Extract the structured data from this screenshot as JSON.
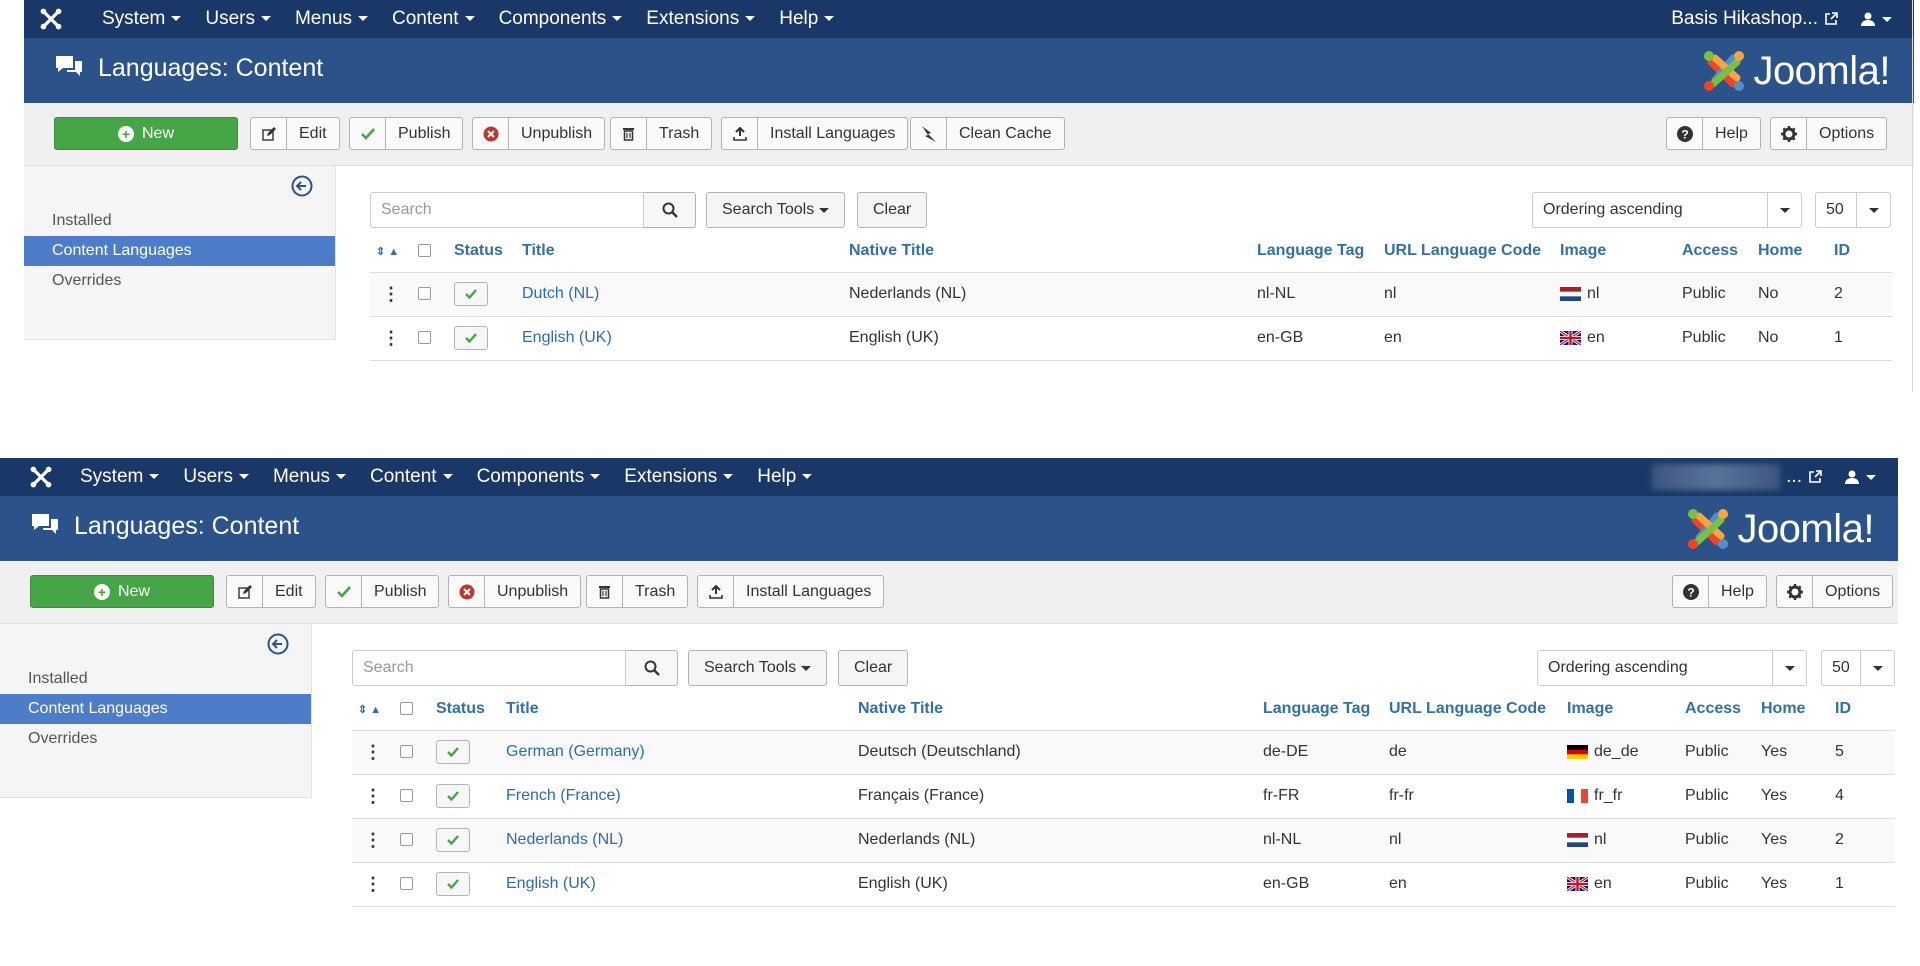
{
  "shots": [
    {
      "menu": [
        "System",
        "Users",
        "Menus",
        "Content",
        "Components",
        "Extensions",
        "Help"
      ],
      "site_link": "Basis Hikashop...",
      "title": "Languages: Content",
      "brand": "Joomla!",
      "toolbar": {
        "new": "New",
        "edit": "Edit",
        "publish": "Publish",
        "unpublish": "Unpublish",
        "trash": "Trash",
        "install": "Install Languages",
        "clean_cache": "Clean Cache",
        "help": "Help",
        "options": "Options"
      },
      "sidebar": [
        "Installed",
        "Content Languages",
        "Overrides"
      ],
      "search_placeholder": "Search",
      "search_tools": "Search Tools",
      "clear": "Clear",
      "ordering": "Ordering ascending",
      "limit": "50",
      "columns": [
        "Status",
        "Title",
        "Native Title",
        "Language Tag",
        "URL Language Code",
        "Image",
        "Access",
        "Home",
        "ID"
      ],
      "rows": [
        {
          "title": "Dutch (NL)",
          "native": "Nederlands (NL)",
          "tag": "nl-NL",
          "code": "nl",
          "flag": "nl",
          "image": "nl",
          "access": "Public",
          "home": "No",
          "id": "2"
        },
        {
          "title": "English (UK)",
          "native": "English (UK)",
          "tag": "en-GB",
          "code": "en",
          "flag": "gb",
          "image": "en",
          "access": "Public",
          "home": "No",
          "id": "1"
        }
      ]
    },
    {
      "menu": [
        "System",
        "Users",
        "Menus",
        "Content",
        "Components",
        "Extensions",
        "Help"
      ],
      "site_link": "...",
      "title": "Languages: Content",
      "brand": "Joomla!",
      "toolbar": {
        "new": "New",
        "edit": "Edit",
        "publish": "Publish",
        "unpublish": "Unpublish",
        "trash": "Trash",
        "install": "Install Languages",
        "help": "Help",
        "options": "Options"
      },
      "sidebar": [
        "Installed",
        "Content Languages",
        "Overrides"
      ],
      "search_placeholder": "Search",
      "search_tools": "Search Tools",
      "clear": "Clear",
      "ordering": "Ordering ascending",
      "limit": "50",
      "columns": [
        "Status",
        "Title",
        "Native Title",
        "Language Tag",
        "URL Language Code",
        "Image",
        "Access",
        "Home",
        "ID"
      ],
      "rows": [
        {
          "title": "German (Germany)",
          "native": "Deutsch (Deutschland)",
          "tag": "de-DE",
          "code": "de",
          "flag": "de",
          "image": "de_de",
          "access": "Public",
          "home": "Yes",
          "id": "5"
        },
        {
          "title": "French (France)",
          "native": "Français (France)",
          "tag": "fr-FR",
          "code": "fr-fr",
          "flag": "fr",
          "image": "fr_fr",
          "access": "Public",
          "home": "Yes",
          "id": "4"
        },
        {
          "title": "Nederlands (NL)",
          "native": "Nederlands (NL)",
          "tag": "nl-NL",
          "code": "nl",
          "flag": "nl",
          "image": "nl",
          "access": "Public",
          "home": "Yes",
          "id": "2"
        },
        {
          "title": "English (UK)",
          "native": "English (UK)",
          "tag": "en-GB",
          "code": "en",
          "flag": "gb",
          "image": "en",
          "access": "Public",
          "home": "Yes",
          "id": "1"
        }
      ]
    }
  ],
  "colors": {
    "navbar": "#1a3867",
    "header": "#2b5289",
    "new_button": "#46a546",
    "active_sidebar": "#4d7cc8",
    "link": "#2a6bba"
  }
}
